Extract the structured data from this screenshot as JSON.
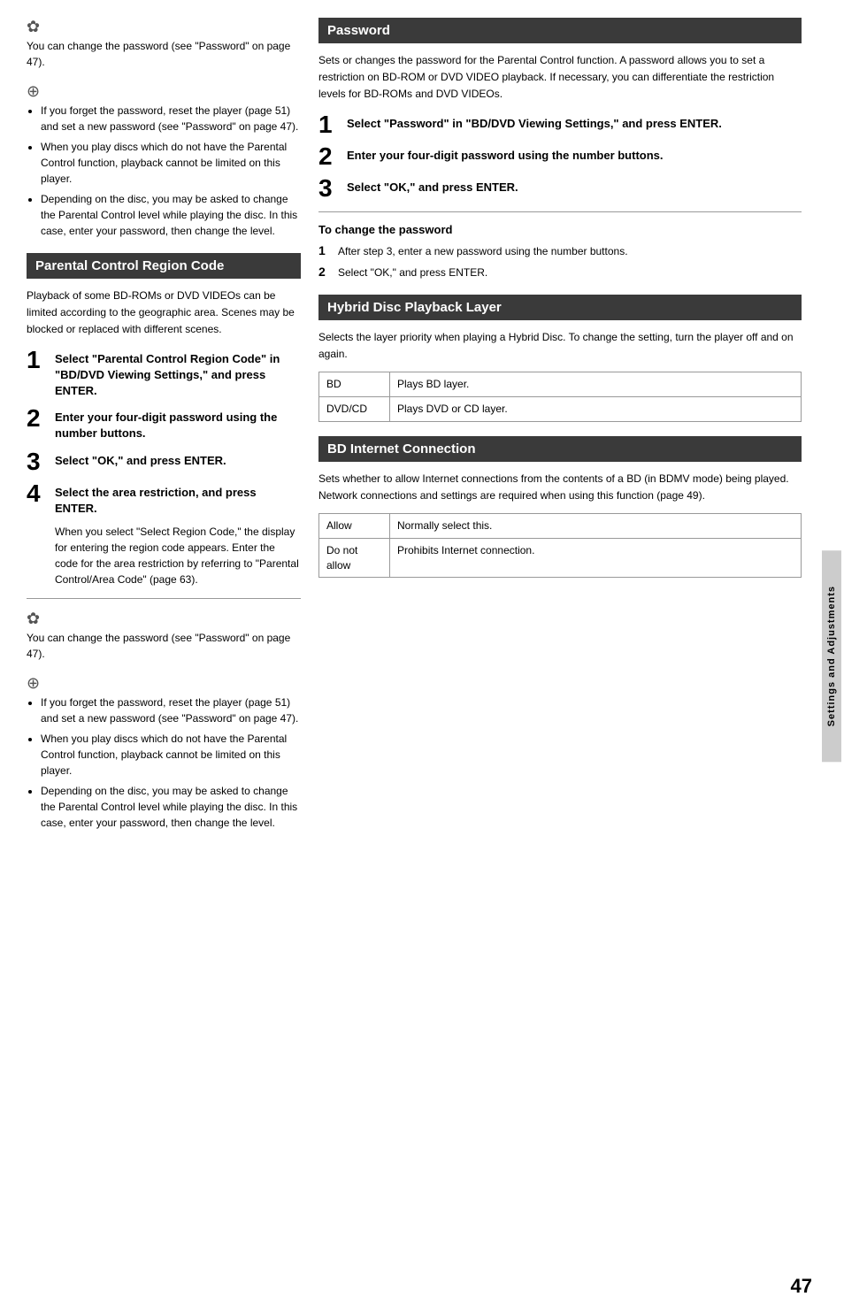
{
  "page": {
    "number": "47",
    "side_tab_label": "Settings and Adjustments"
  },
  "left": {
    "tip1": {
      "icon": "✿",
      "text": "You can change the password (see \"Password\" on page 47)."
    },
    "note1": {
      "icon": "⊕",
      "items": [
        "If you forget the password, reset the player (page 51) and set a new password (see \"Password\" on page 47).",
        "When you play discs which do not have the Parental Control function, playback cannot be limited on this player.",
        "Depending on the disc, you may be asked to change the Parental Control level while playing the disc. In this case, enter your password, then change the level."
      ]
    },
    "parental_section": {
      "header": "Parental Control Region Code",
      "body": "Playback of some BD-ROMs or DVD VIDEOs can be limited according to the geographic area. Scenes may be blocked or replaced with different scenes.",
      "steps": [
        {
          "num": "1",
          "text": "Select \"Parental Control Region Code\" in \"BD/DVD Viewing Settings,\" and press ENTER."
        },
        {
          "num": "2",
          "text": "Enter your four-digit password using the number buttons."
        },
        {
          "num": "3",
          "text": "Select \"OK,\" and press ENTER."
        },
        {
          "num": "4",
          "text": "Select the area restriction, and press ENTER.",
          "sub": "When you select \"Select Region Code,\" the display for entering the region code appears. Enter the code for the area restriction by referring to \"Parental Control/Area Code\" (page 63)."
        }
      ]
    },
    "tip2": {
      "icon": "✿",
      "text": "You can change the password (see \"Password\" on page 47)."
    },
    "note2": {
      "icon": "⊕",
      "items": [
        "If you forget the password, reset the player (page 51) and set a new password (see \"Password\" on page 47).",
        "When you play discs which do not have the Parental Control function, playback cannot be limited on this player.",
        "Depending on the disc, you may be asked to change the Parental Control level while playing the disc. In this case, enter your password, then change the level."
      ]
    }
  },
  "right": {
    "password_section": {
      "header": "Password",
      "body": "Sets or changes the password for the Parental Control function. A password allows you to set a restriction on BD-ROM or DVD VIDEO playback. If necessary, you can differentiate the restriction levels for BD-ROMs and DVD VIDEOs.",
      "steps": [
        {
          "num": "1",
          "text": "Select \"Password\" in \"BD/DVD Viewing Settings,\" and press ENTER."
        },
        {
          "num": "2",
          "text": "Enter your four-digit password using the number buttons."
        },
        {
          "num": "3",
          "text": "Select \"OK,\" and press ENTER."
        }
      ],
      "sub_heading": "To change the password",
      "change_steps": [
        {
          "num": "1",
          "text": "After step 3, enter a new password using the number buttons."
        },
        {
          "num": "2",
          "text": "Select \"OK,\" and press ENTER."
        }
      ]
    },
    "hybrid_section": {
      "header": "Hybrid Disc Playback Layer",
      "body": "Selects the layer priority when playing a Hybrid Disc. To change the setting, turn the player off and on again.",
      "table": [
        {
          "col1": "BD",
          "col2": "Plays BD layer."
        },
        {
          "col1": "DVD/CD",
          "col2": "Plays DVD or CD layer."
        }
      ]
    },
    "bd_internet_section": {
      "header": "BD Internet Connection",
      "body": "Sets whether to allow Internet connections from the contents of a BD (in BDMV mode) being played. Network connections and settings are required when using this function (page 49).",
      "table": [
        {
          "col1": "Allow",
          "col2": "Normally select this."
        },
        {
          "col1": "Do not allow",
          "col2": "Prohibits Internet connection."
        }
      ]
    }
  }
}
